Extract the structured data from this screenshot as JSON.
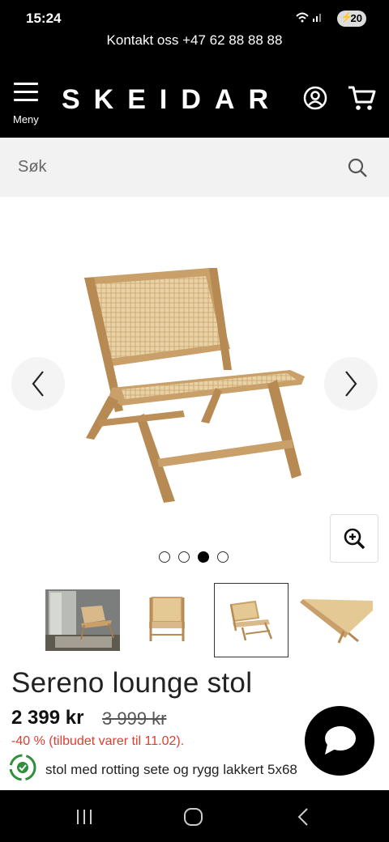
{
  "status_bar": {
    "time": "15:24",
    "battery": "20",
    "network": "4G"
  },
  "header": {
    "contact": "Kontakt oss +47 62 88 88 88",
    "menu_label": "Meny",
    "logo": "SKEIDAR"
  },
  "search": {
    "placeholder": "Søk"
  },
  "gallery": {
    "dot_count": 4,
    "active_dot_index": 2
  },
  "product": {
    "title": "Sereno lounge stol",
    "price": "2 399 kr",
    "old_price": "3 999 kr",
    "discount": "-40 % (tilbudet varer til 11.02).",
    "description": "stol med rotting sete og rygg lakkert 5x68"
  },
  "colors": {
    "accent_red": "#e03c31",
    "brand_black": "#000000",
    "search_bg": "#f2f2f2",
    "wood": "#c9a06a",
    "rattan": "#e7cfa2"
  },
  "icons": [
    "menu-icon",
    "user-icon",
    "cart-icon",
    "search-icon",
    "chevron-left-icon",
    "chevron-right-icon",
    "zoom-in-icon",
    "eco-icon",
    "chat-icon"
  ]
}
